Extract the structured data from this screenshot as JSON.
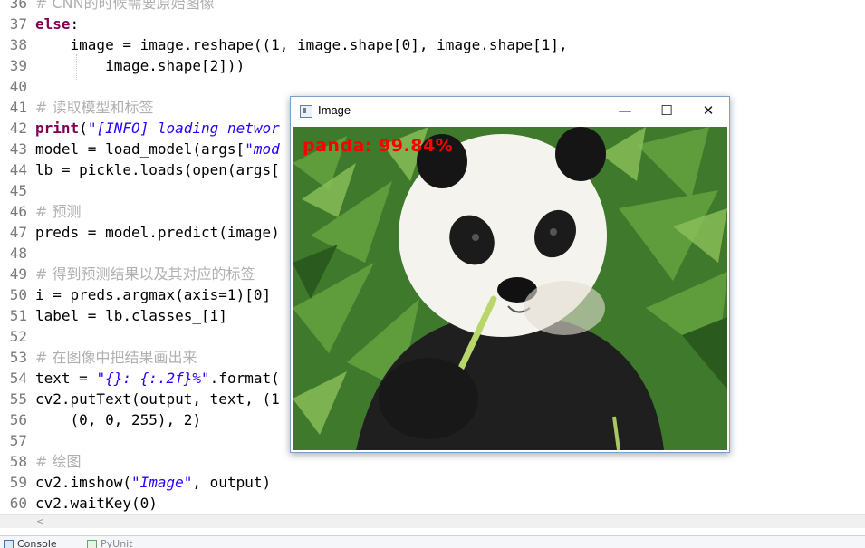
{
  "editor": {
    "lines": [
      {
        "n": "36",
        "segs": [
          {
            "t": "# CNN的时候需要原始图像",
            "c": "cmt"
          }
        ]
      },
      {
        "n": "37",
        "segs": [
          {
            "t": "else",
            "c": "kw"
          },
          {
            "t": ":",
            "c": ""
          }
        ]
      },
      {
        "n": "38",
        "segs": [
          {
            "t": "    image = image.reshape((",
            "c": ""
          },
          {
            "t": "1",
            "c": "num"
          },
          {
            "t": ", image.shape[",
            "c": ""
          },
          {
            "t": "0",
            "c": "num"
          },
          {
            "t": "], image.shape[",
            "c": ""
          },
          {
            "t": "1",
            "c": "num"
          },
          {
            "t": "],",
            "c": ""
          }
        ]
      },
      {
        "n": "39",
        "segs": [
          {
            "t": "        image.shape[",
            "c": ""
          },
          {
            "t": "2",
            "c": "num"
          },
          {
            "t": "]))",
            "c": ""
          }
        ]
      },
      {
        "n": "40",
        "segs": []
      },
      {
        "n": "41",
        "segs": [
          {
            "t": "# 读取模型和标签",
            "c": "cmt"
          }
        ]
      },
      {
        "n": "42",
        "segs": [
          {
            "t": "print",
            "c": "kw"
          },
          {
            "t": "(",
            "c": ""
          },
          {
            "t": "\"[INFO] loading networ",
            "c": "str"
          }
        ]
      },
      {
        "n": "43",
        "segs": [
          {
            "t": "model = load_model(args[",
            "c": ""
          },
          {
            "t": "\"mod",
            "c": "str"
          }
        ]
      },
      {
        "n": "44",
        "segs": [
          {
            "t": "lb = pickle.loads(open(args[",
            "c": ""
          }
        ]
      },
      {
        "n": "45",
        "segs": []
      },
      {
        "n": "46",
        "segs": [
          {
            "t": "# 预测",
            "c": "cmt"
          }
        ]
      },
      {
        "n": "47",
        "segs": [
          {
            "t": "preds = model.predict(image)",
            "c": ""
          }
        ]
      },
      {
        "n": "48",
        "segs": []
      },
      {
        "n": "49",
        "segs": [
          {
            "t": "# 得到预测结果以及其对应的标签",
            "c": "cmt"
          }
        ]
      },
      {
        "n": "50",
        "segs": [
          {
            "t": "i = preds.argmax(axis=",
            "c": ""
          },
          {
            "t": "1",
            "c": "num"
          },
          {
            "t": ")[",
            "c": ""
          },
          {
            "t": "0",
            "c": "num"
          },
          {
            "t": "]",
            "c": ""
          }
        ]
      },
      {
        "n": "51",
        "segs": [
          {
            "t": "label = lb.classes_[i]",
            "c": ""
          }
        ]
      },
      {
        "n": "52",
        "segs": []
      },
      {
        "n": "53",
        "segs": [
          {
            "t": "# 在图像中把结果画出来",
            "c": "cmt"
          }
        ]
      },
      {
        "n": "54",
        "segs": [
          {
            "t": "text = ",
            "c": ""
          },
          {
            "t": "\"{}: {:.2f}%\"",
            "c": "str"
          },
          {
            "t": ".format(",
            "c": ""
          }
        ]
      },
      {
        "n": "55",
        "segs": [
          {
            "t": "cv2.putText(output, text, (1",
            "c": ""
          }
        ]
      },
      {
        "n": "56",
        "segs": [
          {
            "t": "    (",
            "c": ""
          },
          {
            "t": "0",
            "c": "num"
          },
          {
            "t": ", ",
            "c": ""
          },
          {
            "t": "0",
            "c": "num"
          },
          {
            "t": ", ",
            "c": ""
          },
          {
            "t": "255",
            "c": "num"
          },
          {
            "t": "), ",
            "c": ""
          },
          {
            "t": "2",
            "c": "num"
          },
          {
            "t": ")",
            "c": ""
          }
        ]
      },
      {
        "n": "57",
        "segs": []
      },
      {
        "n": "58",
        "segs": [
          {
            "t": "# 绘图",
            "c": "cmt"
          }
        ]
      },
      {
        "n": "59",
        "segs": [
          {
            "t": "cv2.imshow(",
            "c": ""
          },
          {
            "t": "\"Image\"",
            "c": "str"
          },
          {
            "t": ", output)",
            "c": ""
          }
        ]
      },
      {
        "n": "60",
        "segs": [
          {
            "t": "cv2.waitKey(",
            "c": ""
          },
          {
            "t": "0",
            "c": "num"
          },
          {
            "t": ")",
            "c": ""
          }
        ]
      }
    ]
  },
  "scrollbar": {
    "left_arrow": "<"
  },
  "bottom_tabs": {
    "console": "Console",
    "pyunit": "PyUnit"
  },
  "image_window": {
    "title": "Image",
    "minimize_glyph": "—",
    "maximize_glyph": "☐",
    "close_glyph": "✕",
    "overlay_text": "panda: 99.84%",
    "overlay_color": "#ff0000"
  },
  "colors": {
    "keyword": "#7f0055",
    "string": "#2a00ff",
    "comment": "#b0b0b0",
    "line_number": "#7a7a7a"
  }
}
